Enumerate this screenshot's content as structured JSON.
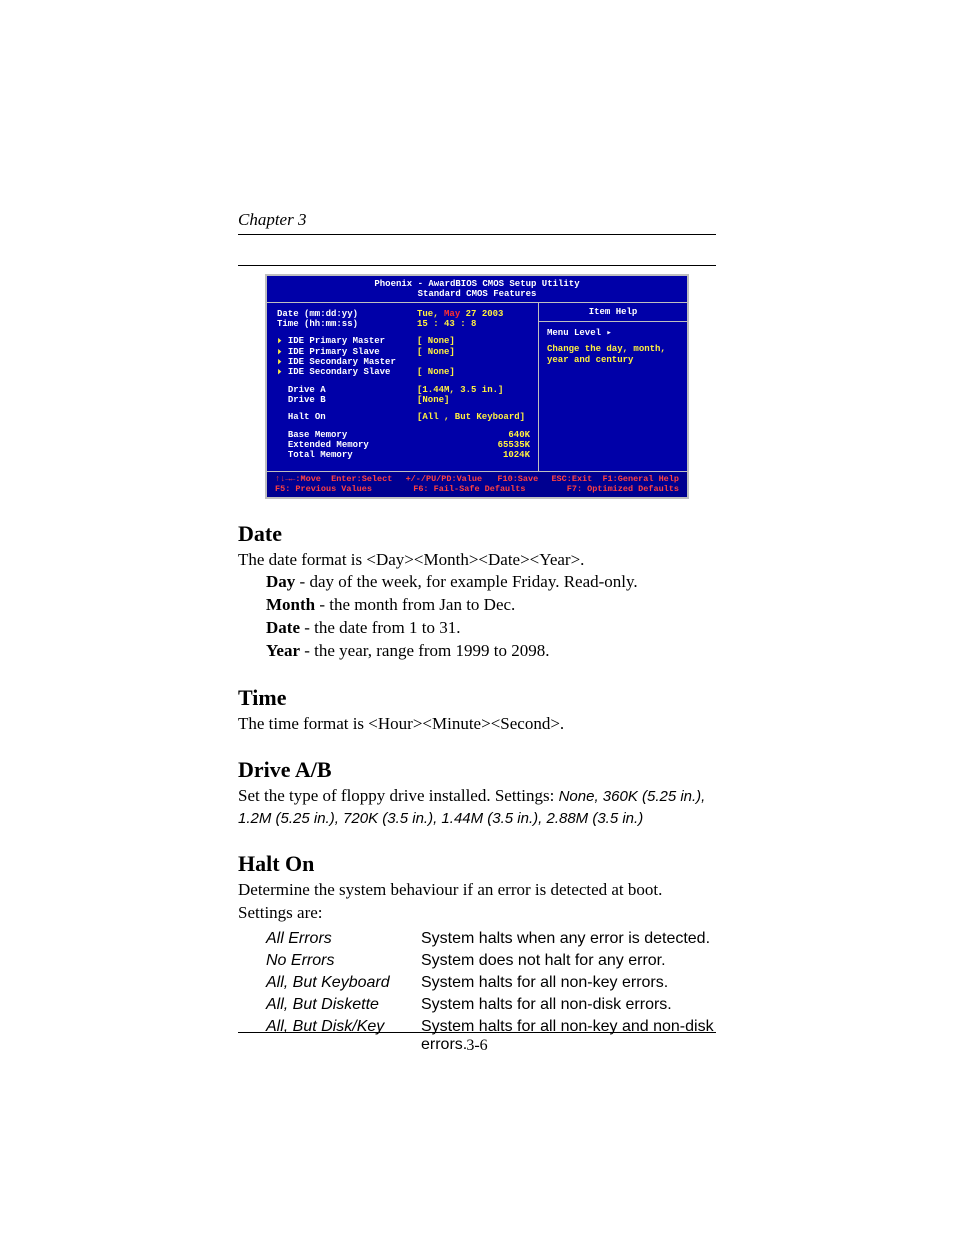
{
  "header": {
    "chapter": "Chapter 3"
  },
  "bios": {
    "title_line1": "Phoenix - AwardBIOS CMOS Setup Utility",
    "title_line2": "Standard CMOS Features",
    "rows": {
      "date_label": "Date (mm:dd:yy)",
      "date_val_prefix": "Tue, ",
      "date_val_highlight": "May",
      "date_val_suffix": " 27 2003",
      "time_label": "Time (hh:mm:ss)",
      "time_val": "15 : 43 :  8",
      "ide_pm": "IDE Primary Master",
      "ide_ps": "IDE Primary Slave",
      "ide_sm": "IDE Secondary Master",
      "ide_ss": "IDE Secondary Slave",
      "none": "[ None]",
      "drive_a": "Drive A",
      "drive_a_val": "[1.44M, 3.5 in.]",
      "drive_b": "Drive B",
      "drive_b_val": "[None]",
      "halt_on": "Halt On",
      "halt_on_val": "[All , But Keyboard]",
      "base_mem": "Base Memory",
      "base_mem_val": "640K",
      "ext_mem": "Extended Memory",
      "ext_mem_val": "65535K",
      "total_mem": "Total Memory",
      "total_mem_val": "1024K"
    },
    "help": {
      "title": "Item Help",
      "menu_level": "Menu Level   ▸",
      "text": "Change the day, month, year and century"
    },
    "footer": {
      "l1a": "↑↓→←:Move  Enter:Select",
      "l1b": "+/-/PU/PD:Value   F10:Save",
      "l1c": "ESC:Exit  F1:General Help",
      "l2a": "F5: Previous Values",
      "l2b": "F6: Fail-Safe Defaults",
      "l2c": "F7: Optimized Defaults"
    }
  },
  "sections": {
    "date": {
      "heading": "Date",
      "intro": "The date format is <Day><Month><Date><Year>.",
      "day_b": "Day",
      "day_t": " - day of the week, for example Friday. Read-only.",
      "month_b": "Month",
      "month_t": " - the month from Jan to Dec.",
      "dte_b": "Date",
      "dte_t": " - the date from 1 to 31.",
      "year_b": "Year",
      "year_t": " - the year, range from 1999 to 2098."
    },
    "time": {
      "heading": "Time",
      "intro": "The time format is <Hour><Minute><Second>."
    },
    "drive": {
      "heading": "Drive A/B",
      "intro_a": "Set the type of floppy drive installed.  Settings: ",
      "intro_b": "None, 360K (5.25 in.), 1.2M (5.25 in.), 720K (3.5 in.), 1.44M (3.5 in.), 2.88M (3.5 in.)"
    },
    "halt": {
      "heading": "Halt On",
      "intro": "Determine the system behaviour if an error is detected at boot. Settings are:",
      "opts": [
        {
          "o": "All Errors",
          "d": "System halts when any error is detected."
        },
        {
          "o": "No Errors",
          "d": "System does not halt for any error."
        },
        {
          "o": "All, But Keyboard",
          "d": "System halts for all non-key errors."
        },
        {
          "o": "All, But Diskette",
          "d": "System halts for all non-disk errors."
        },
        {
          "o": "All, But Disk/Key",
          "d": "System halts for all non-key and non-disk errors."
        }
      ]
    }
  },
  "page_number": "3-6"
}
